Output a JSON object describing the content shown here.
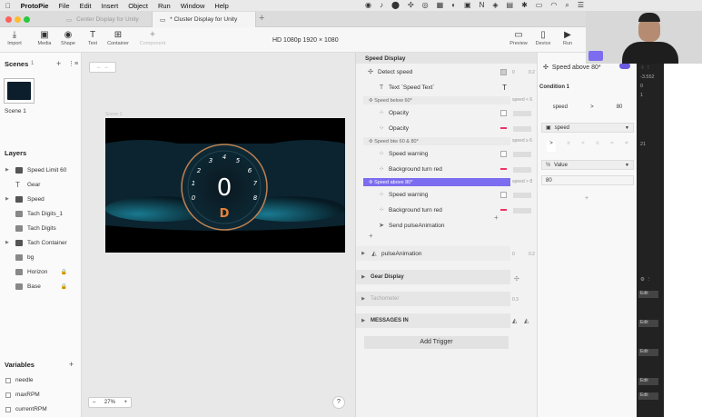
{
  "menubar": {
    "app": "ProtoPie",
    "items": [
      "File",
      "Edit",
      "Insert",
      "Object",
      "Run",
      "Window",
      "Help"
    ]
  },
  "tabs": [
    {
      "label": "Center Display for Unity"
    },
    {
      "label": "* Cluster Display for Unity"
    }
  ],
  "toolbar": {
    "left": [
      "Import",
      "Media",
      "Shape",
      "Text",
      "Container",
      "Component"
    ],
    "resolution": "HD 1080p  1920 × 1080",
    "right": [
      "Preview",
      "Device",
      "Run"
    ]
  },
  "scenes": {
    "title": "Scenes",
    "count": "1",
    "scene_label": "Scene 1"
  },
  "layers": {
    "title": "Layers",
    "items": [
      {
        "label": "Speed Limit 60"
      },
      {
        "label": "Gear"
      },
      {
        "label": "Speed"
      },
      {
        "label": "Tach Digits_1"
      },
      {
        "label": "Tach Digits"
      },
      {
        "label": "Tach Container"
      },
      {
        "label": "bg"
      },
      {
        "label": "Horizon"
      },
      {
        "label": "Base"
      }
    ]
  },
  "variables": {
    "title": "Variables",
    "items": [
      "needle",
      "maxRPM",
      "currentRPM"
    ]
  },
  "canvas": {
    "scene_tag": "Scene 1",
    "zoom": "27%",
    "gauge": {
      "speed": "0",
      "gear": "D",
      "ticks": [
        "0",
        "1",
        "2",
        "3",
        "4",
        "5",
        "6",
        "7",
        "8"
      ]
    }
  },
  "interaction": {
    "header": "Speed Display",
    "trigger": "Detect speed",
    "text_response": "Text `Speed Text`",
    "cond1": "Speed below 60*",
    "r_opacity1": "Opacity",
    "r_opacity2": "Opacity",
    "cond2": "Speed btw 60 & 80*",
    "r_warning1": "Speed warning",
    "r_bg1": "Background turn red",
    "cond3": "Speed above 80*",
    "r_warning2": "Speed warning",
    "r_bg2": "Background turn red",
    "r_send": "Send pulseAnimation",
    "pulse": "pulseAnimation",
    "gear_display": "Gear Display",
    "tachometer": "Tachometer",
    "messages": "MESSAGES IN",
    "add_trigger": "Add Trigger",
    "side_labels": [
      "0",
      "0.2",
      "speed < 6",
      "speed ≥ 6",
      "speed > 8",
      "0",
      "0.2",
      "0.3"
    ]
  },
  "props": {
    "title": "Speed above 80*",
    "condition": "Condition 1",
    "var": "speed",
    "op": ">",
    "val": "80",
    "select_var": "speed",
    "ops": [
      ">",
      "≥",
      "<",
      "≤",
      "=",
      "≠"
    ],
    "value_label": "Value",
    "value": "80"
  },
  "dark_values": [
    "-3.552",
    "0",
    "1",
    "21"
  ],
  "dark_buttons": [
    "Edit",
    "Edit",
    "Edit",
    "Edit",
    "Edit",
    "Edit"
  ]
}
